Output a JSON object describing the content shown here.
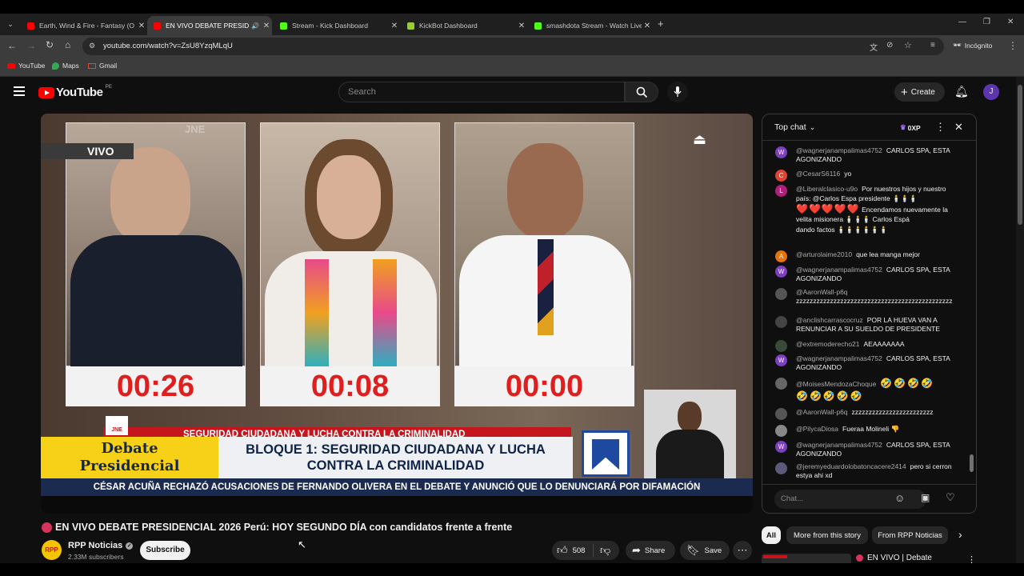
{
  "browser": {
    "tabs": [
      {
        "title": "Earth, Wind & Fire - Fantasy (O",
        "favicon_color": "#ff0000"
      },
      {
        "title": "EN VIVO DEBATE PRESID",
        "favicon_color": "#ff0000",
        "active": true
      },
      {
        "title": "Stream - Kick Dashboard",
        "favicon_color": "#53fc18"
      },
      {
        "title": "KickBot Dashboard",
        "favicon_color": "#9acd32"
      },
      {
        "title": "smashdota Stream - Watch Live",
        "favicon_color": "#53fc18"
      }
    ],
    "url": "youtube.com/watch?v=ZsU8YzqMLqU",
    "incognito_label": "Incógnito",
    "bookmarks": [
      "YouTube",
      "Maps",
      "Gmail"
    ]
  },
  "youtube": {
    "logo_text": "YouTube",
    "country_code": "PE",
    "search_placeholder": "Search",
    "create_label": "Create",
    "avatar_letter": "J"
  },
  "video": {
    "live_badge": "VIVO",
    "watermark": "JNE",
    "timers": [
      "00:26",
      "00:08",
      "00:00"
    ],
    "debate_title": "Debate Presidencial",
    "debate_line1": "Debate",
    "debate_line2": "Presidencial",
    "bloque_line1": "BLOQUE 1: SEGURIDAD CIUDADANA Y LUCHA",
    "bloque_line2": "CONTRA LA CRIMINALIDAD",
    "top_strip": "SEGURIDAD CIUDADANA Y LUCHA CONTRA LA CRIMINALIDAD",
    "ticker": "CÉSAR ACUÑA RECHAZÓ ACUSACIONES DE FERNANDO OLIVERA EN EL DEBATE Y ANUNCIÓ QUE LO DENUNCIARÁ POR DIFAMACIÓN",
    "jne_label": "JNE",
    "title": "EN VIVO DEBATE PRESIDENCIAL 2026 Perú: HOY SEGUNDO DÍA con candidatos frente a frente",
    "channel_logo": "RPP",
    "channel_name": "RPP Noticias",
    "subscribers": "2.33M subscribers",
    "subscribe_label": "Subscribe",
    "likes": "508",
    "share_label": "Share",
    "save_label": "Save"
  },
  "chat": {
    "mode_label": "Top chat",
    "xp_label": "0XP",
    "input_placeholder": "Chat...",
    "messages": [
      {
        "author": "@wagnerjanampalimas4752",
        "text": "CARLOS SPA, ESTA AGONIZANDO",
        "avatar": "W",
        "color": "#7b3fbf"
      },
      {
        "author": "@CesarS6116",
        "text": "yo",
        "avatar": "C",
        "color": "#e0432f"
      },
      {
        "author": "@Liberalclasico-u9o",
        "text": "Por nuestros hijos y nuestro país: @Carlos Espa presidente 🕯️🕯️🕯️",
        "avatar": "L",
        "color": "#b0207a",
        "hearts": "❤️❤️❤️❤️❤️",
        "tail1": "Encendamos nuevamente la velita misionera 🕯️🕯️🕯️ Carlos Espá",
        "tail2": "dando factos 🕯️🕯️🕯️🕯️🕯️🕯️"
      },
      {
        "author": "@arturolaime2010",
        "text": "que lea manga mejor",
        "avatar": "A",
        "color": "#e8710a"
      },
      {
        "author": "@wagnerjanampalimas4752",
        "text": "CARLOS SPA, ESTA AGONIZANDO",
        "avatar": "W",
        "color": "#7b3fbf"
      },
      {
        "author": "@AaronWall-p6q",
        "text": "zzzzzzzzzzzzzzzzzzzzzzzzzzzzzzzzzzzzzzzzzzzzzz",
        "avatar": "",
        "color": "#555"
      },
      {
        "author": "@anclishcarrascocruz",
        "text": "POR LA HUEVA VAN A RENUNCIAR A SU SUELDO DE PRESIDENTE",
        "avatar": "",
        "color": "#444"
      },
      {
        "author": "@extremoderecho21",
        "text": "AEAAAAAAA",
        "avatar": "",
        "color": "#3a4a3a"
      },
      {
        "author": "@wagnerjanampalimas4752",
        "text": "CARLOS SPA, ESTA AGONIZANDO",
        "avatar": "W",
        "color": "#7b3fbf"
      },
      {
        "author": "@MoisesMendozaChoque",
        "text": "🤣🤣🤣🤣",
        "avatar": "",
        "color": "#666",
        "extra": "🤣🤣🤣🤣🤣"
      },
      {
        "author": "@AaronWall-p6q",
        "text": "zzzzzzzzzzzzzzzzzzzzzzzz",
        "avatar": "",
        "color": "#555"
      },
      {
        "author": "@PilycaDiosa",
        "text": "Fueraa Molineli 👎",
        "avatar": "",
        "color": "#888"
      },
      {
        "author": "@wagnerjanampalimas4752",
        "text": "CARLOS SPA, ESTA AGONIZANDO",
        "avatar": "W",
        "color": "#7b3fbf"
      },
      {
        "author": "@jeremyeduardolobatoncacere2414",
        "text": "pero si cerron estya ahi xd",
        "avatar": "",
        "color": "#5a5a7a"
      }
    ]
  },
  "related": {
    "chips": [
      "All",
      "More from this story",
      "From RPP Noticias"
    ],
    "first_video_title": "EN VIVO | Debate"
  }
}
